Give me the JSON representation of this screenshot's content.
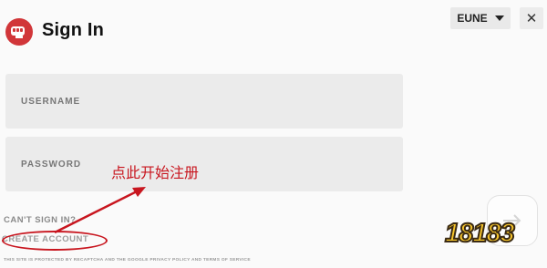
{
  "header": {
    "title": "Sign In",
    "region": "EUNE",
    "close_glyph": "✕"
  },
  "form": {
    "username_placeholder": "USERNAME",
    "password_placeholder": "PASSWORD",
    "cant_sign_in": "CAN'T SIGN IN?",
    "create_account": "CREATE ACCOUNT",
    "recaptcha_note": "THIS SITE IS PROTECTED BY RECAPTCHA AND THE GOOGLE PRIVACY POLICY AND TERMS OF SERVICE"
  },
  "annotation": {
    "text": "点此开始注册",
    "color": "#c8161f"
  },
  "watermark": {
    "text": "18183"
  },
  "colors": {
    "brand": "#d13639",
    "annotation": "#c8161f",
    "field_bg": "#ebebeb"
  },
  "icons": [
    "riot-fist-icon",
    "chevron-down-icon",
    "close-icon",
    "arrow-right-icon"
  ]
}
